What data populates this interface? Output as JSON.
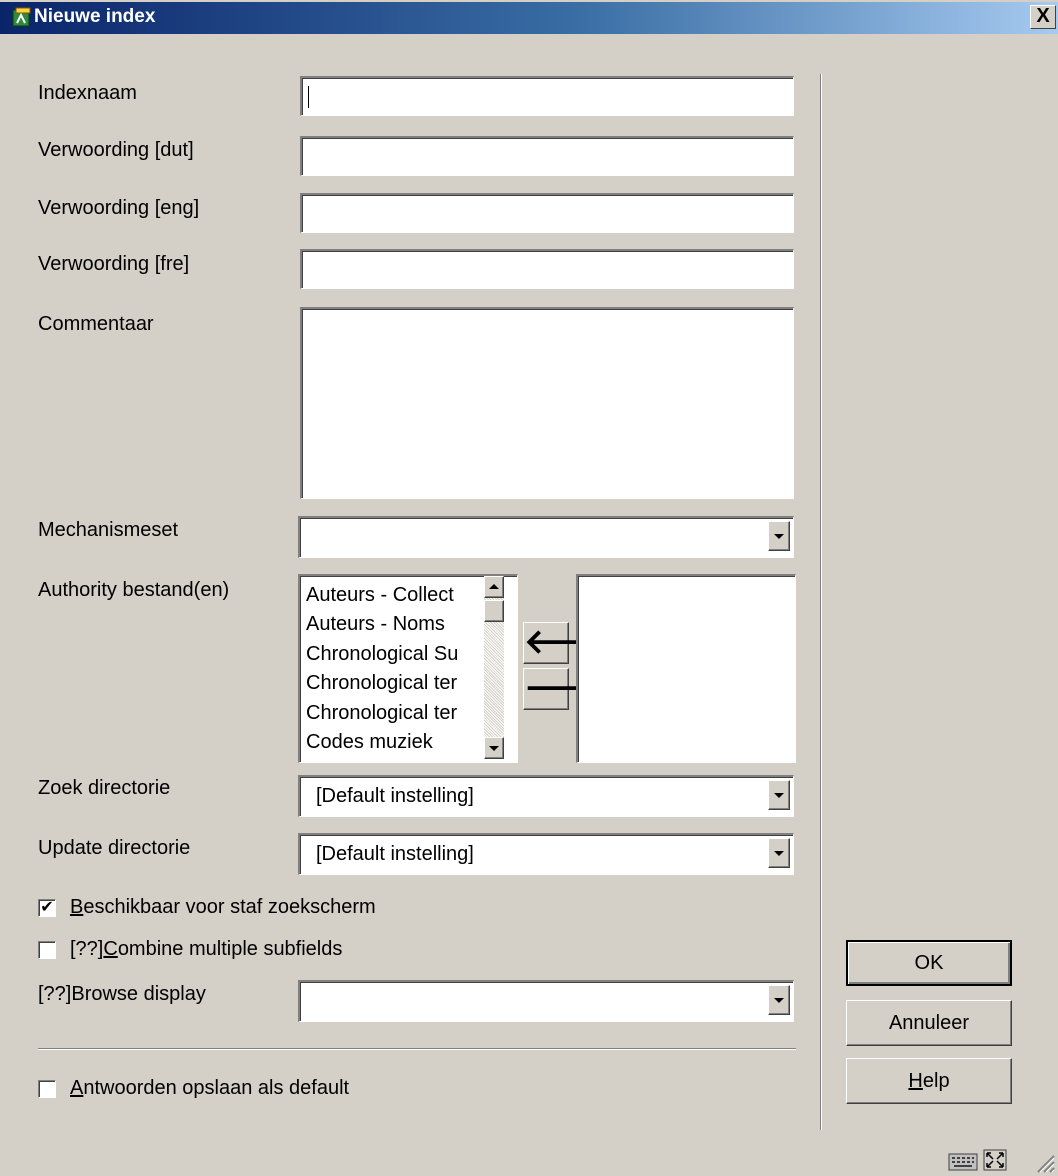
{
  "window": {
    "title": "Nieuwe index",
    "close_label": "X"
  },
  "form": {
    "indexnaam": {
      "label": "Indexnaam",
      "value": ""
    },
    "verwoording_dut": {
      "label": "Verwoording [dut]",
      "value": ""
    },
    "verwoording_eng": {
      "label": "Verwoording [eng]",
      "value": ""
    },
    "verwoording_fre": {
      "label": "Verwoording [fre]",
      "value": ""
    },
    "commentaar": {
      "label": "Commentaar",
      "value": ""
    },
    "mechanismeset": {
      "label": "Mechanismeset",
      "value": ""
    },
    "authority": {
      "label": "Authority bestand(en)",
      "available": [
        "Auteurs - Collect",
        "Auteurs - Noms",
        "Chronological Su",
        "Chronological ter",
        "Chronological ter",
        "Codes muziek"
      ],
      "selected": [],
      "add_glyph": "🡐",
      "remove_glyph": "🡒"
    },
    "zoek_directorie": {
      "label": "Zoek directorie",
      "value": "[Default instelling]"
    },
    "update_directorie": {
      "label": "Update directorie",
      "value": "[Default instelling]"
    },
    "beschikbaar": {
      "accel": "B",
      "rest": "eschikbaar voor staf zoekscherm",
      "checked": true
    },
    "combine": {
      "prefix": "[??]",
      "accel": "C",
      "rest": "ombine multiple subfields",
      "checked": false
    },
    "browse_display": {
      "label": "[??]Browse display",
      "value": ""
    },
    "antwoorden": {
      "accel": "A",
      "rest": "ntwoorden opslaan als default",
      "checked": false
    }
  },
  "buttons": {
    "ok": "OK",
    "cancel": "Annuleer",
    "help_accel": "H",
    "help_rest": "elp"
  },
  "icons": {
    "title": "app-window-icon",
    "keyboard": "keyboard-icon",
    "resize": "resize-icon"
  }
}
